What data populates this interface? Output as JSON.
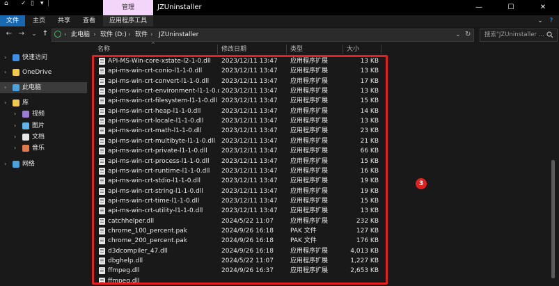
{
  "titlebar": {
    "manage_tab": "管理",
    "title": "JZUninstaller",
    "quick_access": [
      "⌂",
      "✓",
      "▯",
      "▾",
      "|"
    ],
    "min": "—",
    "max": "☐",
    "close": "✕"
  },
  "ribbon": {
    "tabs": [
      "文件",
      "主页",
      "共享",
      "查看"
    ],
    "app_tools": "应用程序工具",
    "expand": "⌄",
    "help": "?"
  },
  "address": {
    "back": "←",
    "forward": "→",
    "recent": "⌄",
    "up": "↑",
    "crumbs": [
      "此电脑",
      "软件 (D:)",
      "软件",
      "JZUninstaller"
    ],
    "sep": "›",
    "dropdown": "⌄",
    "refresh": "↻",
    "search_placeholder": "搜索\"JZUninstaller ...",
    "search_icon": "search-icon"
  },
  "nav": {
    "items": [
      {
        "label": "快速访问",
        "icon": "star-icon",
        "color": "#3c8ee6",
        "indent": 0
      },
      {
        "label": "OneDrive",
        "icon": "cloud-icon",
        "color": "#f2c94c",
        "indent": 0
      },
      {
        "label": "此电脑",
        "icon": "computer-icon",
        "color": "#4aa3df",
        "indent": 0,
        "selected": true
      },
      {
        "label": "库",
        "icon": "library-icon",
        "color": "#f2c94c",
        "indent": 0
      },
      {
        "label": "视频",
        "icon": "video-icon",
        "color": "#9b7bd4",
        "indent": 1
      },
      {
        "label": "图片",
        "icon": "picture-icon",
        "color": "#5fb3e8",
        "indent": 1
      },
      {
        "label": "文档",
        "icon": "document-icon",
        "color": "#e8e8e8",
        "indent": 1
      },
      {
        "label": "音乐",
        "icon": "music-icon",
        "color": "#e07c4c",
        "indent": 1
      },
      {
        "label": "网络",
        "icon": "network-icon",
        "color": "#4aa3df",
        "indent": 0
      }
    ]
  },
  "columns": {
    "name": "名称",
    "date": "修改日期",
    "type": "类型",
    "size": "大小"
  },
  "files": [
    {
      "name": "API-MS-Win-core-xstate-l2-1-0.dll",
      "date": "2023/12/11 13:47",
      "type": "应用程序扩展",
      "size": "13 KB"
    },
    {
      "name": "api-ms-win-crt-conio-l1-1-0.dll",
      "date": "2023/12/11 13:47",
      "type": "应用程序扩展",
      "size": "13 KB"
    },
    {
      "name": "api-ms-win-crt-convert-l1-1-0.dll",
      "date": "2023/12/11 13:47",
      "type": "应用程序扩展",
      "size": "17 KB"
    },
    {
      "name": "api-ms-win-crt-environment-l1-1-0.dll",
      "date": "2023/12/11 13:47",
      "type": "应用程序扩展",
      "size": "13 KB"
    },
    {
      "name": "api-ms-win-crt-filesystem-l1-1-0.dll",
      "date": "2023/12/11 13:47",
      "type": "应用程序扩展",
      "size": "15 KB"
    },
    {
      "name": "api-ms-win-crt-heap-l1-1-0.dll",
      "date": "2023/12/11 13:47",
      "type": "应用程序扩展",
      "size": "14 KB"
    },
    {
      "name": "api-ms-win-crt-locale-l1-1-0.dll",
      "date": "2023/12/11 13:47",
      "type": "应用程序扩展",
      "size": "13 KB"
    },
    {
      "name": "api-ms-win-crt-math-l1-1-0.dll",
      "date": "2023/12/11 13:47",
      "type": "应用程序扩展",
      "size": "23 KB"
    },
    {
      "name": "api-ms-win-crt-multibyte-l1-1-0.dll",
      "date": "2023/12/11 13:47",
      "type": "应用程序扩展",
      "size": "21 KB"
    },
    {
      "name": "api-ms-win-crt-private-l1-1-0.dll",
      "date": "2023/12/11 13:47",
      "type": "应用程序扩展",
      "size": "66 KB"
    },
    {
      "name": "api-ms-win-crt-process-l1-1-0.dll",
      "date": "2023/12/11 13:47",
      "type": "应用程序扩展",
      "size": "15 KB"
    },
    {
      "name": "api-ms-win-crt-runtime-l1-1-0.dll",
      "date": "2023/12/11 13:47",
      "type": "应用程序扩展",
      "size": "16 KB"
    },
    {
      "name": "api-ms-win-crt-stdio-l1-1-0.dll",
      "date": "2023/12/11 13:47",
      "type": "应用程序扩展",
      "size": "19 KB"
    },
    {
      "name": "api-ms-win-crt-string-l1-1-0.dll",
      "date": "2023/12/11 13:47",
      "type": "应用程序扩展",
      "size": "19 KB"
    },
    {
      "name": "api-ms-win-crt-time-l1-1-0.dll",
      "date": "2023/12/11 13:47",
      "type": "应用程序扩展",
      "size": "15 KB"
    },
    {
      "name": "api-ms-win-crt-utility-l1-1-0.dll",
      "date": "2023/12/11 13:47",
      "type": "应用程序扩展",
      "size": "13 KB"
    },
    {
      "name": "catchhelper.dll",
      "date": "2024/5/22 11:07",
      "type": "应用程序扩展",
      "size": "232 KB"
    },
    {
      "name": "chrome_100_percent.pak",
      "date": "2024/9/26 16:18",
      "type": "PAK 文件",
      "size": "127 KB"
    },
    {
      "name": "chrome_200_percent.pak",
      "date": "2024/9/26 16:18",
      "type": "PAK 文件",
      "size": "176 KB"
    },
    {
      "name": "d3dcompiler_47.dll",
      "date": "2024/9/26 16:18",
      "type": "应用程序扩展",
      "size": "4,013 KB"
    },
    {
      "name": "dbghelp.dll",
      "date": "2024/5/22 11:07",
      "type": "应用程序扩展",
      "size": "1,227 KB"
    },
    {
      "name": "ffmpeg.dll",
      "date": "2024/9/26 16:37",
      "type": "应用程序扩展",
      "size": "2,653 KB"
    },
    {
      "name": "ffmpeg.dll",
      "date": "",
      "type": "",
      "size": ""
    }
  ],
  "annotation": {
    "marker": "3",
    "highlight_color": "#e12121"
  }
}
